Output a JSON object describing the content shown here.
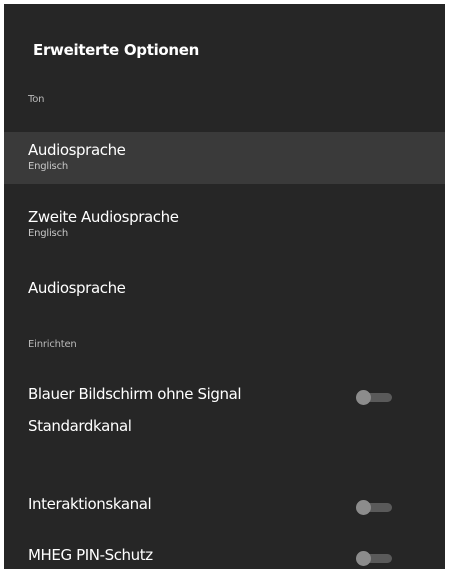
{
  "panel": {
    "title": "Erweiterte Optionen"
  },
  "sections": {
    "ton": "Ton",
    "einrichten": "Einrichten"
  },
  "items": [
    {
      "title": "Audiosprache",
      "subtitle": "Englisch",
      "focused": true
    },
    {
      "title": "Zweite Audiosprache",
      "subtitle": "Englisch"
    },
    {
      "title": "Audiosprache"
    },
    {
      "title": "Blauer Bildschirm ohne Signal",
      "toggle": "off"
    },
    {
      "title": "Standardkanal"
    },
    {
      "title": "Interaktionskanal",
      "toggle": "off"
    },
    {
      "title": "MHEG PIN-Schutz",
      "toggle": "off"
    }
  ]
}
